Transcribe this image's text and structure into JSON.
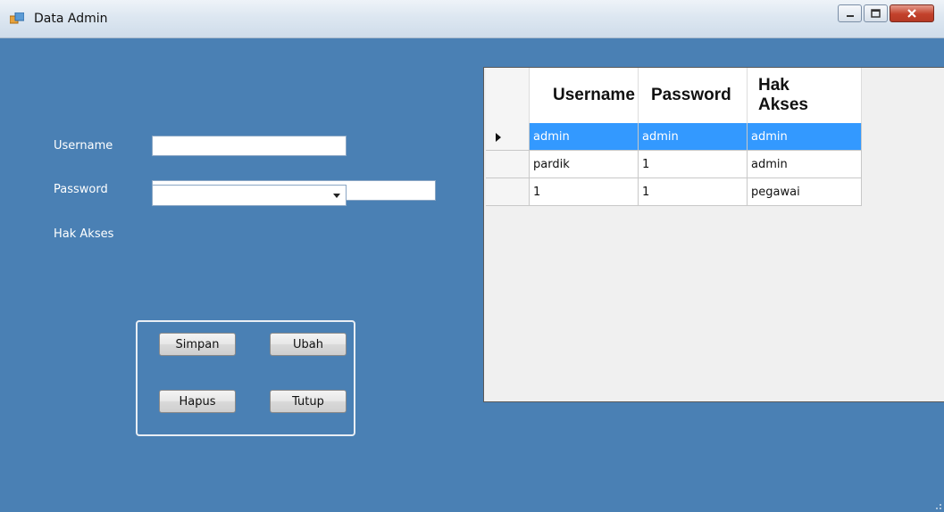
{
  "window": {
    "title": "Data Admin"
  },
  "form": {
    "username_label": "Username",
    "password_label": "Password",
    "hak_akses_label": "Hak Akses",
    "username_value": "",
    "password_value": "",
    "hak_akses_value": ""
  },
  "buttons": {
    "simpan": "Simpan",
    "ubah": "Ubah",
    "hapus": "Hapus",
    "tutup": "Tutup"
  },
  "grid": {
    "columns": [
      "Username",
      "Password",
      "Hak Akses"
    ],
    "col3_line1": "Hak",
    "col3_line2": "Akses",
    "rows": [
      {
        "username": "admin",
        "password": "admin",
        "hak_akses": "admin"
      },
      {
        "username": "pardik",
        "password": "1",
        "hak_akses": "admin"
      },
      {
        "username": "1",
        "password": "1",
        "hak_akses": "pegawai"
      }
    ]
  },
  "colors": {
    "form_bg": "#4a80b4",
    "selection": "#3399ff"
  }
}
